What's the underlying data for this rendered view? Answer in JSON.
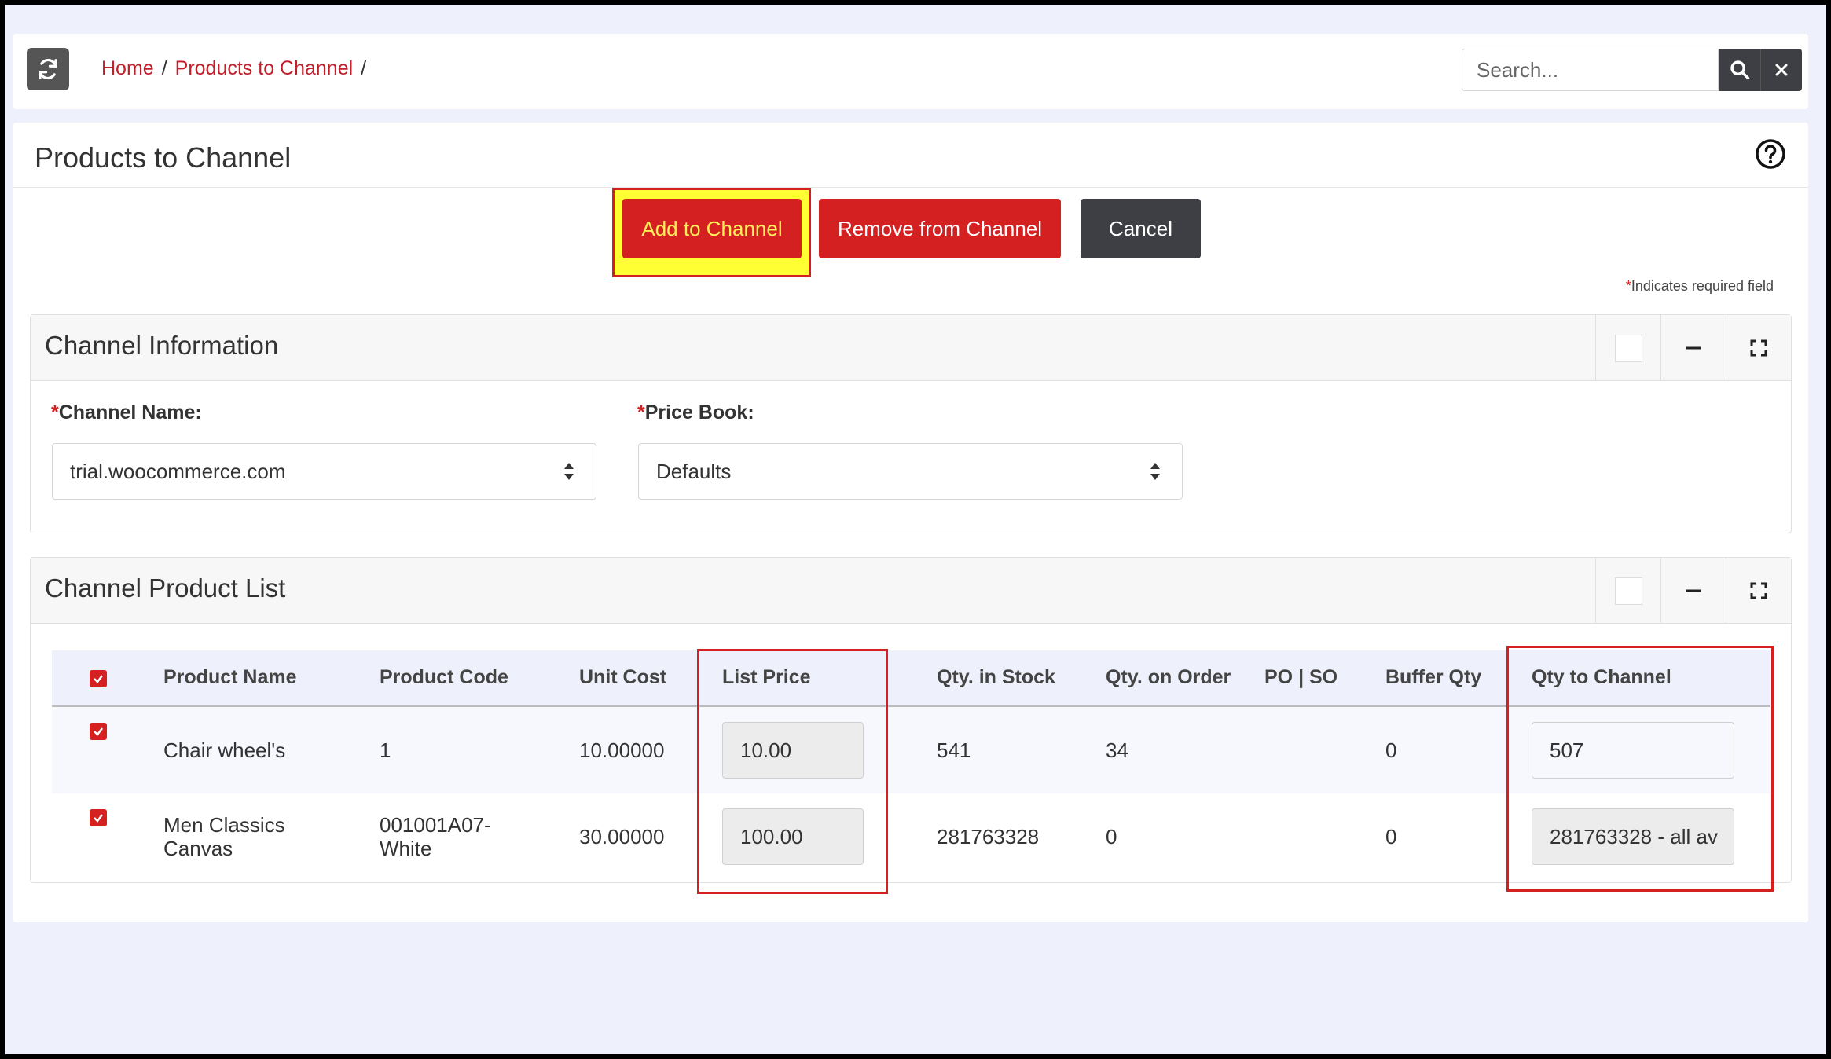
{
  "breadcrumb": {
    "home": "Home",
    "sep": "/",
    "current": "Products to Channel"
  },
  "search": {
    "placeholder": "Search..."
  },
  "page": {
    "title": "Products to Channel"
  },
  "actions": {
    "add": "Add to Channel",
    "remove": "Remove from Channel",
    "cancel": "Cancel"
  },
  "required_note": {
    "star": "*",
    "text": "Indicates required field"
  },
  "channel_info": {
    "title": "Channel Information",
    "channel_name_label": "Channel Name:",
    "channel_name_value": "trial.woocommerce.com",
    "price_book_label": "Price Book:",
    "price_book_value": "Defaults"
  },
  "product_list": {
    "title": "Channel Product List",
    "columns": [
      "Product Name",
      "Product Code",
      "Unit Cost",
      "List Price",
      "Qty. in Stock",
      "Qty. on Order",
      "PO | SO",
      "Buffer Qty",
      "Qty to Channel"
    ],
    "rows": [
      {
        "checked": true,
        "name": "Chair wheel's",
        "code": "1",
        "unit_cost": "10.00000",
        "list_price": "10.00",
        "qty_stock": "541",
        "qty_order": "34",
        "po_so": "",
        "buffer": "0",
        "qty_channel": "507"
      },
      {
        "checked": true,
        "name_line1": "Men Classics",
        "name_line2": "Canvas",
        "code_line1": "001001A07-",
        "code_line2": "White",
        "unit_cost": "30.00000",
        "list_price": "100.00",
        "qty_stock": "281763328",
        "qty_order": "0",
        "po_so": "",
        "buffer": "0",
        "qty_channel": "281763328 - all av"
      }
    ]
  },
  "colors": {
    "accent": "#d42020",
    "dark": "#3d3f44",
    "highlight": "#ffff33"
  }
}
